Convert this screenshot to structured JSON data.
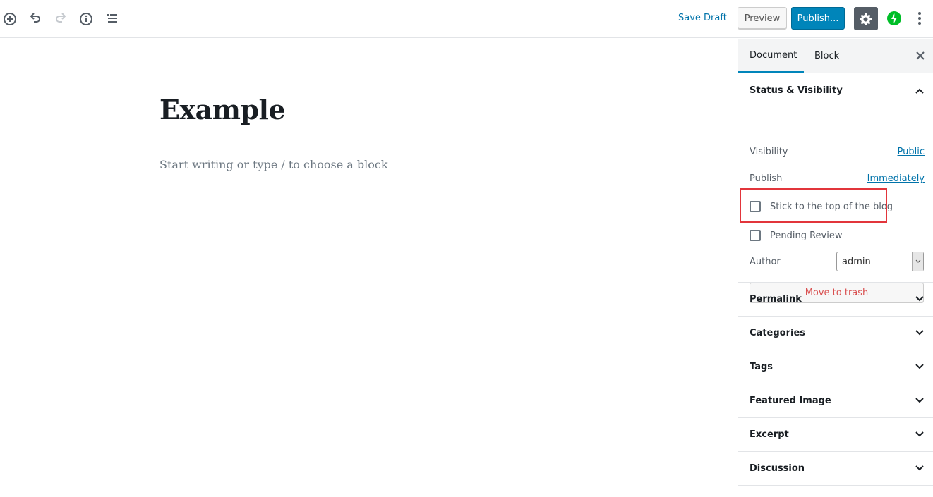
{
  "toolbar": {
    "left_icons": [
      {
        "name": "add-block-icon",
        "label": "Add block"
      },
      {
        "name": "undo-icon",
        "label": "Undo"
      },
      {
        "name": "redo-icon",
        "label": "Redo"
      },
      {
        "name": "info-icon",
        "label": "Content structure"
      },
      {
        "name": "block-navigation-icon",
        "label": "Block navigation"
      }
    ],
    "save_draft": "Save Draft",
    "preview": "Preview",
    "publish": "Publish...",
    "settings_icon": "gear-icon",
    "jetpack_icon": "jetpack-icon",
    "more_icon": "more-vertical-icon"
  },
  "editor": {
    "title": "Example",
    "placeholder": "Start writing or type / to choose a block"
  },
  "sidebar": {
    "tabs": [
      {
        "label": "Document",
        "active": true
      },
      {
        "label": "Block",
        "active": false
      }
    ],
    "status_visibility": {
      "title": "Status & Visibility",
      "visibility_label": "Visibility",
      "visibility_value": "Public",
      "publish_label": "Publish",
      "publish_value": "Immediately",
      "sticky_label": "Stick to the top of the blog",
      "sticky_checked": false,
      "pending_label": "Pending Review",
      "pending_checked": false,
      "author_label": "Author",
      "author_value": "admin",
      "trash_label": "Move to trash"
    },
    "panels": [
      {
        "title": "Permalink"
      },
      {
        "title": "Categories"
      },
      {
        "title": "Tags"
      },
      {
        "title": "Featured Image"
      },
      {
        "title": "Excerpt"
      },
      {
        "title": "Discussion"
      }
    ]
  },
  "colors": {
    "accent": "#0085ba",
    "link": "#0073aa",
    "highlight": "#e2353b",
    "danger": "#d94f4f",
    "jetpack": "#00be28"
  }
}
